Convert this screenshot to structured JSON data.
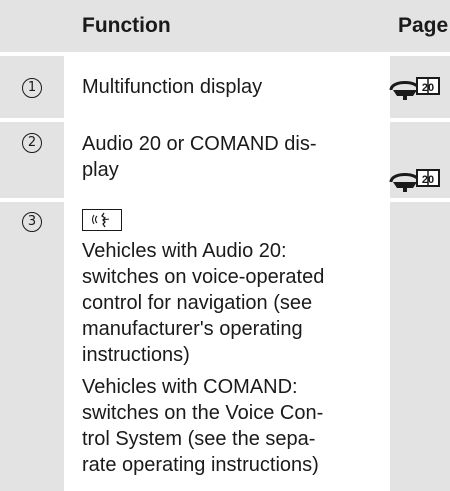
{
  "header": {
    "function_label": "Function",
    "page_label": "Page"
  },
  "rows": [
    {
      "number": "1",
      "function_lines": [
        "Multifunction display"
      ],
      "page_icon": "steering-wheel-book-icon"
    },
    {
      "number": "2",
      "function_lines": [
        "Audio 20 or COMAND dis-",
        "play"
      ],
      "page_icon": "steering-wheel-book-icon"
    },
    {
      "number": "3",
      "button_icon": "voice-control-button-icon",
      "function_lines": [
        "Vehicles with Audio 20:",
        "switches on voice-operated",
        "control for navigation (see",
        "manufacturer's operating",
        "instructions)",
        "Vehicles with COMAND:",
        "switches on the Voice Con-",
        "trol System (see the sepa-",
        "rate operating instructions)"
      ]
    }
  ],
  "colors": {
    "cell_gray": "#e3e3e3",
    "separator": "#ffffff",
    "text": "#1a1a1a"
  }
}
